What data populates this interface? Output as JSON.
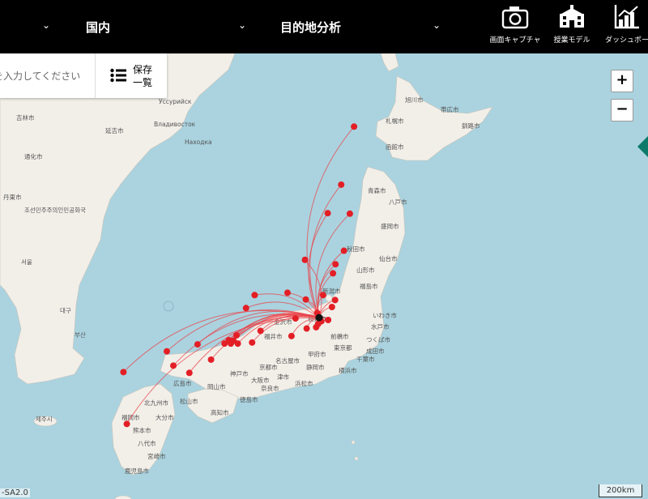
{
  "header": {
    "dropdown_1_label": "",
    "region_label": "国内",
    "analysis_label": "目的地分析",
    "tools": [
      {
        "label": "画面キャプチャ",
        "icon": "camera-icon"
      },
      {
        "label": "授業モデル",
        "icon": "school-icon"
      },
      {
        "label": "ダッシュボー",
        "icon": "dashboard-chart-icon"
      }
    ]
  },
  "search": {
    "placeholder": "を入力してください",
    "save_label_line1": "保存",
    "save_label_line2": "一覧"
  },
  "map_controls": {
    "zoom_in": "+",
    "zoom_out": "−",
    "scale_label": "200km",
    "attribution": "-SA2.0"
  },
  "map_labels": {
    "vladivostok": "Владивосток",
    "ussuriysk": "Уссурийск",
    "nakhodka": "Находка",
    "yanji": "延吉市",
    "jilin": "吉林市",
    "tonghua": "通化市",
    "dandong": "丹東市",
    "korea_dprk": "조선민주주의인민공화국",
    "seoul": "서울",
    "busan": "부산",
    "daegu": "대구",
    "jeju": "제주시",
    "sapporo": "札幌市",
    "hakodate": "函館市",
    "asahikawa": "旭川市",
    "kushiro": "釧路市",
    "obihiro": "帯広市",
    "aomori": "青森市",
    "hachinohe": "八戸市",
    "morioka": "盛岡市",
    "akita": "秋田市",
    "sendai": "仙台市",
    "yamagata": "山形市",
    "fukushima": "福島市",
    "niigata": "新潟市",
    "iwaki": "いわき市",
    "mito": "水戸市",
    "tsukuba": "つくば市",
    "narita": "成田市",
    "maebashi": "前橋市",
    "nagano": "長野市",
    "kanazawa": "金沢市",
    "fukui": "福井市",
    "nagoya": "名古屋市",
    "kofu": "甲府市",
    "shizuoka": "静岡市",
    "hamamatsu": "浜松市",
    "kyoto": "京都市",
    "osaka": "大阪市",
    "kobe": "神戸市",
    "nara": "奈良市",
    "tsu": "津市",
    "tokushima": "徳島市",
    "kochi": "高知市",
    "matsuyama": "松山市",
    "hiroshima": "広島市",
    "okayama": "岡山市",
    "fukuoka": "福岡市",
    "kitakyushu": "北九州市",
    "oita": "大分市",
    "kumamoto": "熊本市",
    "miyazaki": "宮崎市",
    "kagoshima": "鹿児島市",
    "yachiyo": "八代市",
    "tokyo": "東京都",
    "yokohama": "横浜市",
    "chiba": "千葉市"
  },
  "origin": {
    "lon": 139.69,
    "lat": 35.69
  },
  "destinations": [
    {
      "lon": 141.35,
      "lat": 43.06
    },
    {
      "lon": 140.74,
      "lat": 40.82
    },
    {
      "lon": 140.1,
      "lat": 39.72
    },
    {
      "lon": 141.15,
      "lat": 39.7
    },
    {
      "lon": 140.87,
      "lat": 38.27
    },
    {
      "lon": 140.47,
      "lat": 37.75
    },
    {
      "lon": 140.35,
      "lat": 37.4
    },
    {
      "lon": 139.02,
      "lat": 37.92
    },
    {
      "lon": 140.45,
      "lat": 36.37
    },
    {
      "lon": 140.3,
      "lat": 36.1
    },
    {
      "lon": 140.12,
      "lat": 35.6
    },
    {
      "lon": 139.88,
      "lat": 36.56
    },
    {
      "lon": 139.06,
      "lat": 36.39
    },
    {
      "lon": 138.19,
      "lat": 36.65
    },
    {
      "lon": 136.63,
      "lat": 36.56
    },
    {
      "lon": 136.22,
      "lat": 36.06
    },
    {
      "lon": 138.57,
      "lat": 35.66
    },
    {
      "lon": 138.38,
      "lat": 34.98
    },
    {
      "lon": 136.91,
      "lat": 35.18
    },
    {
      "lon": 136.51,
      "lat": 34.73
    },
    {
      "lon": 135.77,
      "lat": 35.01
    },
    {
      "lon": 135.5,
      "lat": 34.69
    },
    {
      "lon": 135.2,
      "lat": 34.69
    },
    {
      "lon": 135.83,
      "lat": 34.69
    },
    {
      "lon": 134.56,
      "lat": 34.07
    },
    {
      "lon": 133.92,
      "lat": 34.66
    },
    {
      "lon": 133.53,
      "lat": 33.56
    },
    {
      "lon": 132.77,
      "lat": 33.84
    },
    {
      "lon": 132.46,
      "lat": 34.39
    },
    {
      "lon": 130.4,
      "lat": 33.59
    },
    {
      "lon": 130.56,
      "lat": 31.59
    },
    {
      "lon": 139.64,
      "lat": 35.44
    },
    {
      "lon": 139.55,
      "lat": 35.32
    },
    {
      "lon": 139.1,
      "lat": 35.27
    },
    {
      "lon": 139.6,
      "lat": 35.87
    },
    {
      "lon": 139.8,
      "lat": 35.55
    },
    {
      "lon": 135.62,
      "lat": 34.8
    },
    {
      "lon": 135.4,
      "lat": 34.82
    }
  ],
  "colors": {
    "arc": "#e8474d",
    "dot": "#e31f26",
    "sea": "#aad3df",
    "land": "#f2efe9",
    "origin": "#111111",
    "sidetab": "#0b7a6a"
  }
}
